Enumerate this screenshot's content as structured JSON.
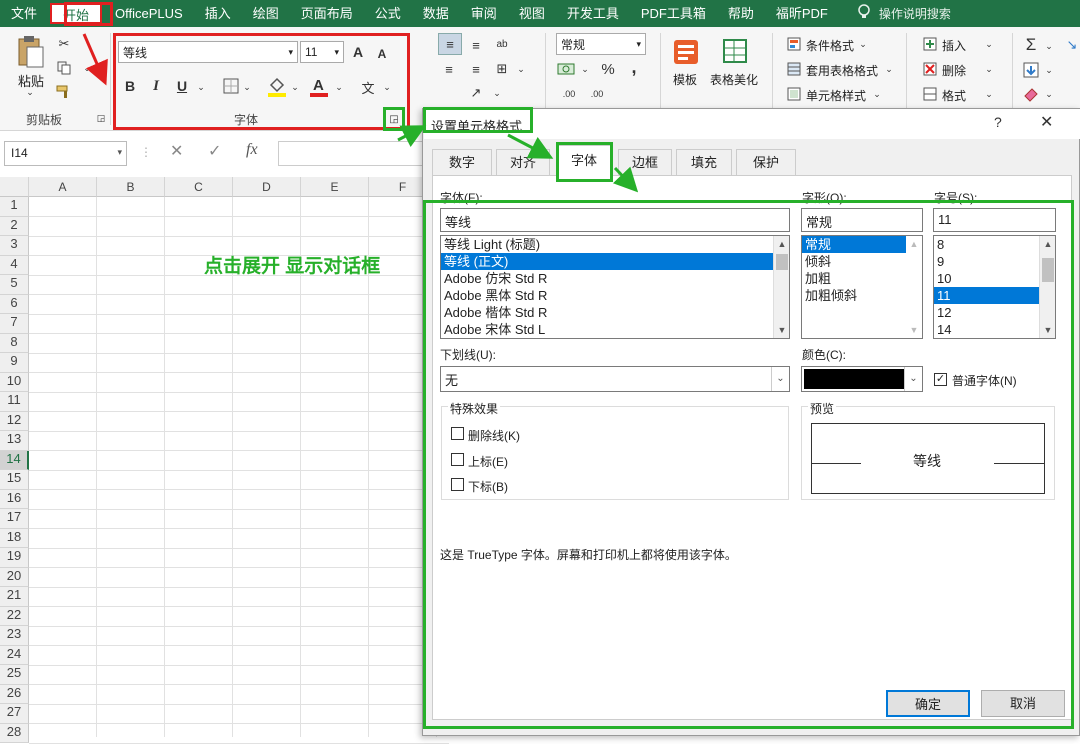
{
  "menubar": {
    "items": [
      "文件",
      "开始",
      "OfficePLUS",
      "插入",
      "绘图",
      "页面布局",
      "公式",
      "数据",
      "审阅",
      "视图",
      "开发工具",
      "PDF工具箱",
      "帮助",
      "福昕PDF"
    ],
    "active_index": 1,
    "search_placeholder": "操作说明搜索"
  },
  "ribbon": {
    "clipboard": {
      "paste_label": "粘贴",
      "group_label": "剪贴板"
    },
    "font": {
      "font_name": "等线",
      "font_size": "11",
      "grow_glyph": "A",
      "shrink_glyph": "A",
      "bold": "B",
      "italic": "I",
      "underline": "U",
      "phonetic": "文",
      "group_label": "字体"
    },
    "number": {
      "format": "常规",
      "percent": "%",
      "comma": ",",
      "inc_decimal": ".00",
      "dec_decimal": ".00"
    },
    "templates": {
      "template_label": "模板",
      "beautify_label": "表格美化"
    },
    "styles": {
      "conditional": "条件格式",
      "table_format": "套用表格格式",
      "cell_style": "单元格样式"
    },
    "cells": {
      "insert": "插入",
      "delete": "删除",
      "format": "格式"
    },
    "editing": {
      "sum": "Σ"
    },
    "colors": {
      "accent": "#217346",
      "highlight_yellow": "#ffeb00",
      "font_red": "#e02020"
    }
  },
  "formula_bar": {
    "name_box": "I14",
    "fx": "fx",
    "cancel": "✕",
    "confirm": "✓"
  },
  "sheet": {
    "columns": [
      "A",
      "B",
      "C",
      "D",
      "E",
      "F"
    ],
    "rows": [
      "1",
      "2",
      "3",
      "4",
      "5",
      "6",
      "7",
      "8",
      "9",
      "10",
      "11",
      "12",
      "13",
      "14",
      "15",
      "16",
      "17",
      "18",
      "19",
      "20",
      "21",
      "22",
      "23",
      "24",
      "25",
      "26",
      "27",
      "28"
    ],
    "active_row": "14"
  },
  "annotation": "点击展开 显示对话框",
  "dialog": {
    "title": "设置单元格格式",
    "help": "?",
    "close": "✕",
    "tabs": [
      "数字",
      "对齐",
      "字体",
      "边框",
      "填充",
      "保护"
    ],
    "active_tab": 2,
    "font_label": "字体(F):",
    "font_value": "等线",
    "font_list": [
      "等线 Light (标题)",
      "等线 (正文)",
      "Adobe 仿宋 Std R",
      "Adobe 黑体 Std R",
      "Adobe 楷体 Std R",
      "Adobe 宋体 Std L"
    ],
    "font_selected": 1,
    "style_label": "字形(O):",
    "style_value": "常规",
    "style_list": [
      "常规",
      "倾斜",
      "加粗",
      "加粗倾斜"
    ],
    "style_selected": 0,
    "size_label": "字号(S):",
    "size_value": "11",
    "size_list": [
      "8",
      "9",
      "10",
      "11",
      "12",
      "14"
    ],
    "size_selected": 3,
    "underline_label": "下划线(U):",
    "underline_value": "无",
    "color_label": "颜色(C):",
    "color_value": "#000000",
    "normal_font_label": "普通字体(N)",
    "effects_label": "特殊效果",
    "effects": [
      "删除线(K)",
      "上标(E)",
      "下标(B)"
    ],
    "preview_label": "预览",
    "preview_text": "等线",
    "info_text": "这是 TrueType 字体。屏幕和打印机上都将使用该字体。",
    "ok": "确定",
    "cancel": "取消"
  }
}
